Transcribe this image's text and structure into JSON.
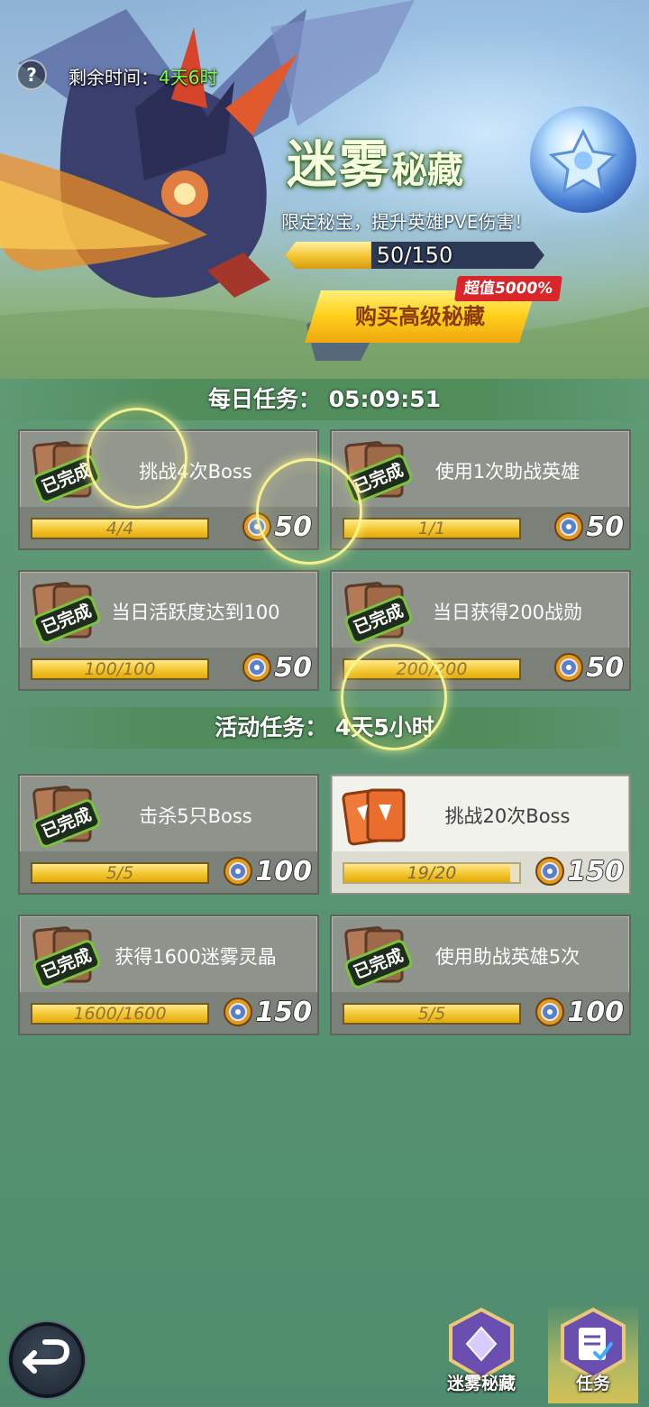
{
  "header": {
    "help_icon": "?",
    "remain_label": "剩余时间：",
    "remain_value": "4天6时"
  },
  "event": {
    "title_big": "迷雾",
    "title_small": "秘藏",
    "subtitle": "限定秘宝，提升英雄PVE伤害！",
    "progress_text": "50/150",
    "progress_fraction": 0.333,
    "buy_button": "购买高级秘藏",
    "value_tag": "超值5000%"
  },
  "daily": {
    "header": "每日任务：  05:09:51",
    "tasks": [
      {
        "name": "挑战4次Boss",
        "progress": "4/4",
        "fraction": 1.0,
        "reward": "50",
        "done_label": "已完成"
      },
      {
        "name": "使用1次助战英雄",
        "progress": "1/1",
        "fraction": 1.0,
        "reward": "50",
        "done_label": "已完成"
      },
      {
        "name": "当日活跃度达到100",
        "progress": "100/100",
        "fraction": 1.0,
        "reward": "50",
        "done_label": "已完成"
      },
      {
        "name": "当日获得200战勋",
        "progress": "200/200",
        "fraction": 1.0,
        "reward": "50",
        "done_label": "已完成"
      }
    ]
  },
  "activity": {
    "header": "活动任务：  4天5小时",
    "tasks": [
      {
        "name": "击杀5只Boss",
        "progress": "5/5",
        "fraction": 1.0,
        "reward": "100",
        "done_label": "已完成"
      },
      {
        "name": "挑战20次Boss",
        "progress": "19/20",
        "fraction": 0.95,
        "reward": "150"
      },
      {
        "name": "获得1600迷雾灵晶",
        "progress": "1600/1600",
        "fraction": 1.0,
        "reward": "150",
        "done_label": "已完成"
      },
      {
        "name": "使用助战英雄5次",
        "progress": "5/5",
        "fraction": 1.0,
        "reward": "100",
        "done_label": "已完成"
      }
    ]
  },
  "nav": {
    "back_icon": "back-arrow-icon",
    "items": [
      {
        "label": "迷雾秘藏",
        "icon": "mist-treasure-icon"
      },
      {
        "label": "任务",
        "icon": "task-scroll-icon"
      }
    ]
  },
  "colors": {
    "timer_green": "#7cff4a",
    "bar_gold": "#f2c228",
    "value_red": "#d8262a"
  }
}
